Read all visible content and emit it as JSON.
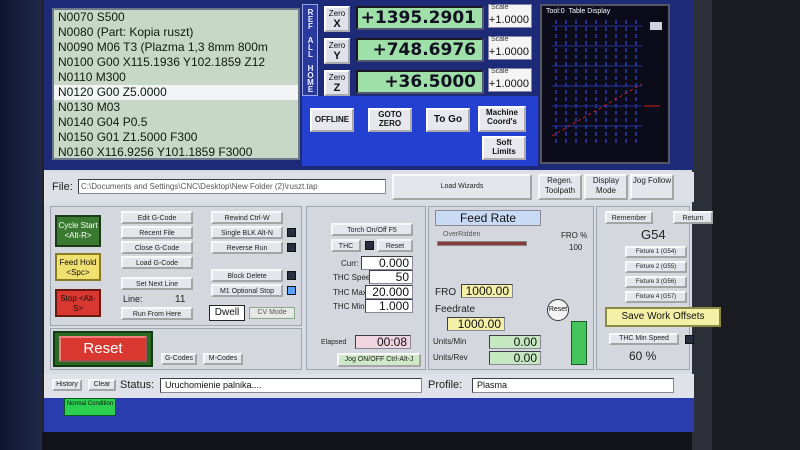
{
  "gcode": {
    "lines": [
      "N0070 S500",
      "N0080 (Part: Kopia ruszt)",
      "N0090 M06 T3 (Plazma 1,3 8mm 800m",
      "N0100 G00 X115.1936 Y102.1859 Z12",
      "N0110 M300",
      "N0120 G00 Z5.0000",
      "N0130 M03",
      "N0140 G04 P0.5",
      "N0150 G01 Z1.5000 F300",
      "N0160 X116.9256 Y101.1859 F3000"
    ],
    "active_index": 5
  },
  "ref_all_home": "REF ALL HOME",
  "axes": [
    {
      "zero_label": "Zero",
      "axis": "X",
      "value": "+1395.2901",
      "scale_label": "Scale",
      "scale": "+1.0000"
    },
    {
      "zero_label": "Zero",
      "axis": "Y",
      "value": "+748.6976",
      "scale_label": "Scale",
      "scale": "+1.0000"
    },
    {
      "zero_label": "Zero",
      "axis": "Z",
      "value": "+36.5000",
      "scale_label": "Scale",
      "scale": "+1.0000"
    }
  ],
  "controls": {
    "offline": "OFFLINE",
    "goto_zero": "GOTO ZERO",
    "to_go": "To Go",
    "machine_coords": "Machine Coord's",
    "soft_limits": "Soft Limits"
  },
  "toolpath": {
    "tool_label": "Tool:0",
    "title": "Table Display"
  },
  "view_buttons": {
    "regen": "Regen. Toolpath",
    "display_mode": "Display Mode",
    "jog_follow": "Jog Follow"
  },
  "file": {
    "label": "File:",
    "path": "C:\\Documents and Settings\\CNC\\Desktop\\New Folder (2)\\ruszt.tap",
    "load_wizards": "Load Wizards"
  },
  "program": {
    "cycle_start": "Cycle Start <Alt-R>",
    "feed_hold": "Feed Hold <Spc>",
    "stop": "Stop <Alt-S>",
    "edit_gcode": "Edit G-Code",
    "recent_file": "Recent File",
    "close_gcode": "Close G-Code",
    "load_gcode": "Load G-Code",
    "set_next_line": "Set Next Line",
    "line_label": "Line:",
    "line_value": "11",
    "run_from_here": "Run From Here",
    "rewind": "Rewind Ctrl-W",
    "single_blk": "Single BLK Alt-N",
    "reverse_run": "Reverse Run",
    "block_delete": "Block Delete",
    "m1_optional_stop": "M1 Optional Stop",
    "dwell": "Dwell",
    "cv_mode": "CV Mode"
  },
  "reset": {
    "label": "Reset",
    "gcodes": "G-Codes",
    "mcodes": "M-Codes"
  },
  "thc": {
    "torch": "Torch On/Off F5",
    "thc": "THC",
    "reset": "Reset",
    "curr_label": "Curr:",
    "curr": "0.000",
    "speed_label": "THC Speed",
    "speed": "50",
    "max_label": "THC Max",
    "max": "20.000",
    "min_label": "THC Min",
    "min": "1.000",
    "elapsed_label": "Elapsed",
    "elapsed": "00:08",
    "jog_toggle": "Jog ON/OFF Ctrl-Alt-J"
  },
  "feed": {
    "title": "Feed Rate",
    "overridden": "OverRidden",
    "fro_pct_label": "FRO %",
    "fro_pct": "100",
    "fro_pct_fill": 1.0,
    "fro_label": "FRO",
    "fro": "1000.00",
    "feedrate_label": "Feedrate",
    "feedrate": "1000.00",
    "reset": "Reset",
    "units_min_label": "Units/Min",
    "units_min": "0.00",
    "units_rev_label": "Units/Rev",
    "units_rev": "0.00"
  },
  "fixtures": {
    "remember": "Remember",
    "return": "Return",
    "current": "G54",
    "f1": "Fixture 1 (G54)",
    "f2": "Fixture 2 (G55)",
    "f3": "Fixture 3 (G56)",
    "f4": "Fixture 4 (G57)",
    "save": "Save Work Offsets",
    "thc_min_speed": "THC Min Speed",
    "percent": "60 %"
  },
  "status": {
    "history": "History",
    "clear": "Clear",
    "label": "Status:",
    "text": "Uruchomienie palnika....",
    "profile_label": "Profile:",
    "profile": "Plasma",
    "normal_condition": "Normal Condition"
  }
}
